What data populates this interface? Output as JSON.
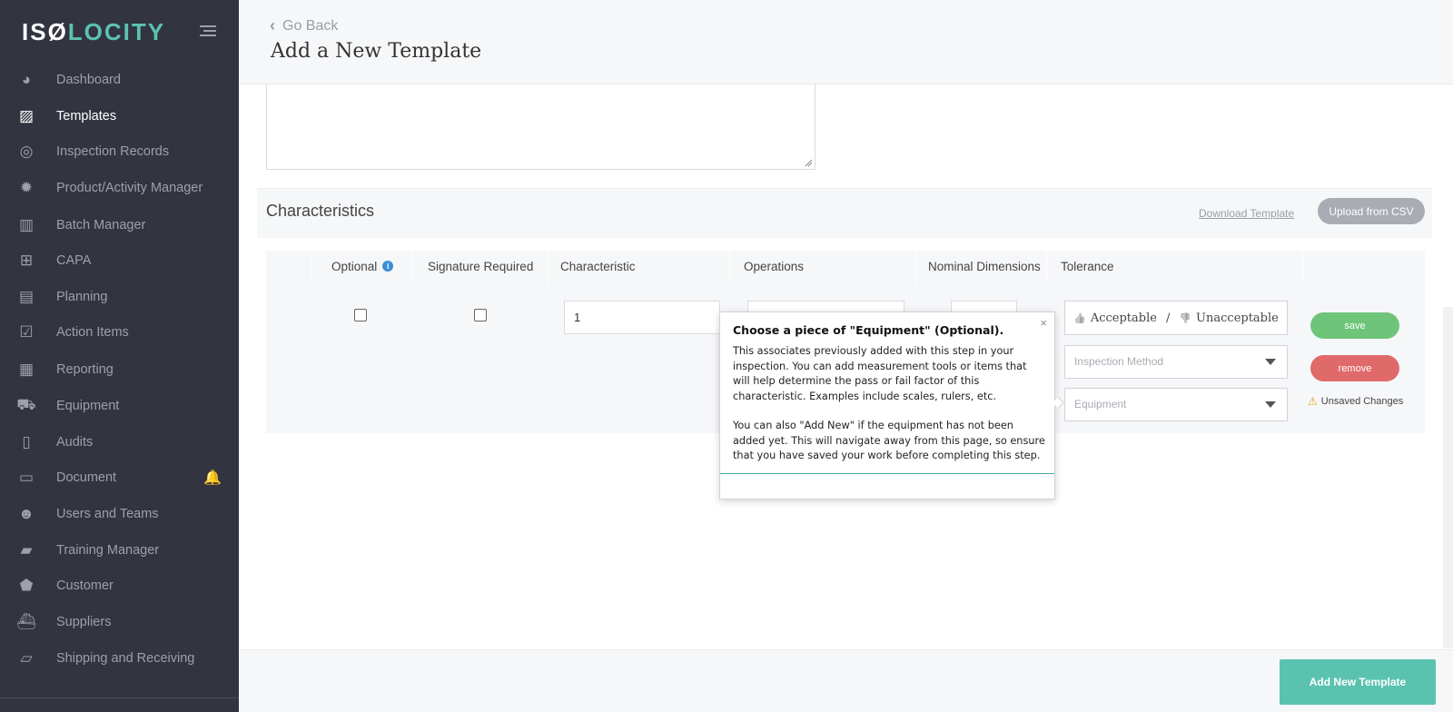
{
  "app": {
    "logo_prefix": "ISØ",
    "logo_accent": "LOCITY"
  },
  "sidebar": {
    "items": [
      {
        "label": "Dashboard",
        "icon": "dashboard-icon",
        "glyph": "◕"
      },
      {
        "label": "Templates",
        "icon": "image-icon",
        "glyph": "▨"
      },
      {
        "label": "Inspection Records",
        "icon": "target-icon",
        "glyph": "◎"
      },
      {
        "label": "Product/Activity Manager",
        "icon": "gear-icon",
        "glyph": "✹"
      },
      {
        "label": "Batch Manager",
        "icon": "barcode-icon",
        "glyph": "▥"
      },
      {
        "label": "CAPA",
        "icon": "medkit-icon",
        "glyph": "⊞"
      },
      {
        "label": "Planning",
        "icon": "map-icon",
        "glyph": "▤"
      },
      {
        "label": "Action Items",
        "icon": "checkbox-icon",
        "glyph": "☑"
      },
      {
        "label": "Reporting",
        "icon": "report-icon",
        "glyph": "▦"
      },
      {
        "label": "Equipment",
        "icon": "truck-icon",
        "glyph": "⛟"
      },
      {
        "label": "Audits",
        "icon": "file-icon",
        "glyph": "▯"
      },
      {
        "label": "Document",
        "icon": "folder-icon",
        "glyph": "▭"
      },
      {
        "label": "Users and Teams",
        "icon": "users-icon",
        "glyph": "☻"
      },
      {
        "label": "Training Manager",
        "icon": "book-icon",
        "glyph": "▰"
      },
      {
        "label": "Customer",
        "icon": "tag-icon",
        "glyph": "⬟"
      },
      {
        "label": "Suppliers",
        "icon": "ship-icon",
        "glyph": "⛴"
      },
      {
        "label": "Shipping and Receiving",
        "icon": "inbox-icon",
        "glyph": "▱"
      }
    ],
    "active_index": 1,
    "bell_glyph": "🔔"
  },
  "header": {
    "back_glyph": "‹",
    "back_label": "Go Back",
    "title": "Add a New Template"
  },
  "characteristics": {
    "title": "Characteristics",
    "download_label": "Download Template",
    "upload_label": "Upload from CSV",
    "columns": {
      "optional": "Optional",
      "signature": "Signature Required",
      "characteristic": "Characteristic",
      "operations": "Operations",
      "nominal": "Nominal Dimensions",
      "tolerance": "Tolerance"
    },
    "info_glyph": "i",
    "row": {
      "characteristic_value": "1",
      "acceptable_label": "Acceptable",
      "unacceptable_label": "Unacceptable",
      "thumbs_up": "👍",
      "thumbs_down": "👎",
      "separator": "/",
      "inspection_method_placeholder": "Inspection Method",
      "equipment_placeholder": "Equipment",
      "save_label": "save",
      "remove_label": "remove",
      "warn_glyph": "⚠",
      "unsaved_label": "Unsaved Changes"
    }
  },
  "popover": {
    "close_glyph": "×",
    "title": "Choose a piece of \"Equipment\" (Optional).",
    "paragraph1": "This associates previously added with this step in your inspection. You can add measurement tools or items that will help determine the pass or fail factor of this characteristic. Examples include scales, rulers, etc.",
    "paragraph2": "You can also \"Add New\" if the equipment has not been added yet. This will navigate away from this page, so ensure that you have saved your work before completing this step."
  },
  "footer": {
    "add_button_label": "Add New Template"
  },
  "colors": {
    "sidebar_bg": "#323440",
    "accent": "#5cc2b0",
    "save": "#6ec57a",
    "remove": "#e06a6a",
    "info": "#3a8fd6"
  }
}
